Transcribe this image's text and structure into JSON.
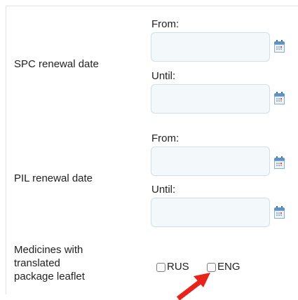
{
  "spc": {
    "label": "SPC renewal date",
    "from_label": "From:",
    "until_label": "Until:",
    "from_value": "",
    "until_value": ""
  },
  "pil": {
    "label": "PIL renewal date",
    "from_label": "From:",
    "until_label": "Until:",
    "from_value": "",
    "until_value": ""
  },
  "medicines": {
    "label_line1": "Medicines with",
    "label_line2": "translated",
    "label_line3": "package leaflet",
    "options": [
      {
        "label": "RUS",
        "checked": false
      },
      {
        "label": "ENG",
        "checked": false
      }
    ]
  },
  "icons": {
    "calendar": "calendar-icon",
    "annotation": "red-arrow-annotation"
  },
  "colors": {
    "field_bg": "#f3f8fa",
    "field_border": "#cfe0e6",
    "arrow": "#e8231b"
  }
}
